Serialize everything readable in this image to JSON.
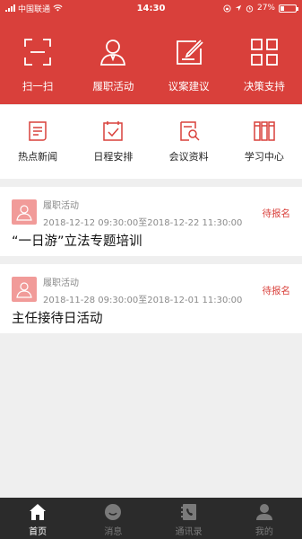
{
  "status_bar": {
    "carrier": "中国联通",
    "time": "14:30",
    "battery": "27%",
    "battery_level": 0.27
  },
  "top_nav": [
    {
      "label": "扫一扫",
      "icon": "scan-icon"
    },
    {
      "label": "履职活动",
      "icon": "person-icon"
    },
    {
      "label": "议案建议",
      "icon": "edit-icon"
    },
    {
      "label": "决策支持",
      "icon": "grid-icon"
    }
  ],
  "sub_nav": [
    {
      "label": "热点新闻",
      "icon": "news-icon"
    },
    {
      "label": "日程安排",
      "icon": "calendar-check-icon"
    },
    {
      "label": "会议资料",
      "icon": "document-search-icon"
    },
    {
      "label": "学习中心",
      "icon": "books-icon"
    }
  ],
  "cards": [
    {
      "type": "履职活动",
      "time": "2018-12-12 09:30:00至2018-12-22 11:30:00",
      "status": "待报名",
      "title": "“一日游”立法专题培训"
    },
    {
      "type": "履职活动",
      "time": "2018-11-28 09:30:00至2018-12-01 11:30:00",
      "status": "待报名",
      "title": "主任接待日活动"
    }
  ],
  "tab_bar": [
    {
      "label": "首页",
      "icon": "home-icon",
      "active": true
    },
    {
      "label": "消息",
      "icon": "message-icon",
      "active": false
    },
    {
      "label": "通讯录",
      "icon": "contacts-icon",
      "active": false
    },
    {
      "label": "我的",
      "icon": "user-icon",
      "active": false
    }
  ],
  "colors": {
    "brand_red": "#d9403b",
    "avatar_pink": "#f19b99",
    "tabbar_bg": "#2b2b2b"
  }
}
